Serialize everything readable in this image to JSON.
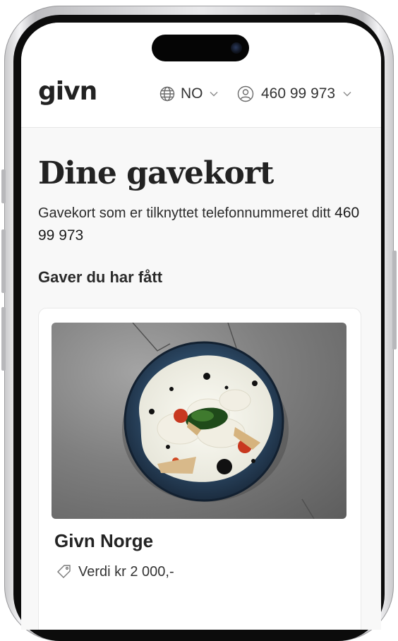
{
  "header": {
    "logo": "givn",
    "language": "NO",
    "phone": "460 99 973"
  },
  "page": {
    "title": "Dine gavekort",
    "subtitle_prefix": "Gavekort som er tilknyttet telefonnummeret ditt",
    "subtitle_phone": "460 99 973",
    "section_title": "Gaver du har fått"
  },
  "gift_card": {
    "title": "Givn Norge",
    "value": "Verdi kr 2 000,-"
  },
  "colors": {
    "background": "#f8f8f8",
    "text": "#222222",
    "plate": "#2e4a66"
  },
  "icons": {
    "language": "globe-icon",
    "language_chevron": "chevron-down-icon",
    "account": "user-circle-icon",
    "account_chevron": "chevron-down-icon",
    "value": "tag-icon"
  }
}
